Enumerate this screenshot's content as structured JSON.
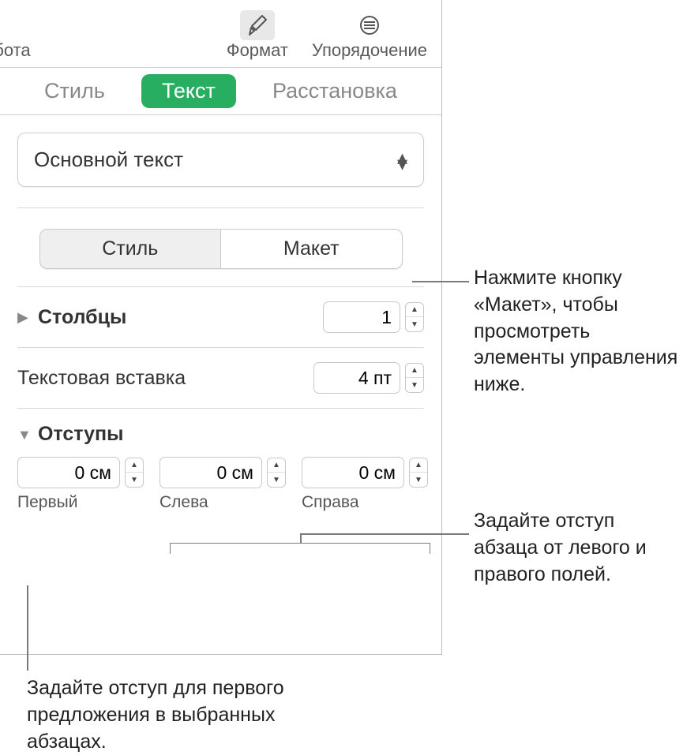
{
  "toolbar": {
    "left_label": "абота",
    "format_label": "Формат",
    "arrange_label": "Упорядочение"
  },
  "tabs": {
    "style": "Стиль",
    "text": "Текст",
    "arrange": "Расстановка"
  },
  "dropdown": {
    "selected": "Основной текст"
  },
  "segmented": {
    "style": "Стиль",
    "layout": "Макет"
  },
  "columns": {
    "label": "Столбцы",
    "value": "1"
  },
  "text_inset": {
    "label": "Текстовая вставка",
    "value": "4 пт"
  },
  "indents": {
    "header": "Отступы",
    "first": {
      "value": "0 см",
      "label": "Первый"
    },
    "left": {
      "value": "0 см",
      "label": "Слева"
    },
    "right": {
      "value": "0 см",
      "label": "Справа"
    }
  },
  "callouts": {
    "layout": "Нажмите кнопку «Макет», чтобы просмотреть элементы управления ниже.",
    "margins": "Задайте отступ абзаца от левого и правого полей.",
    "first_line": "Задайте отступ для первого предложения в выбранных абзацах."
  }
}
